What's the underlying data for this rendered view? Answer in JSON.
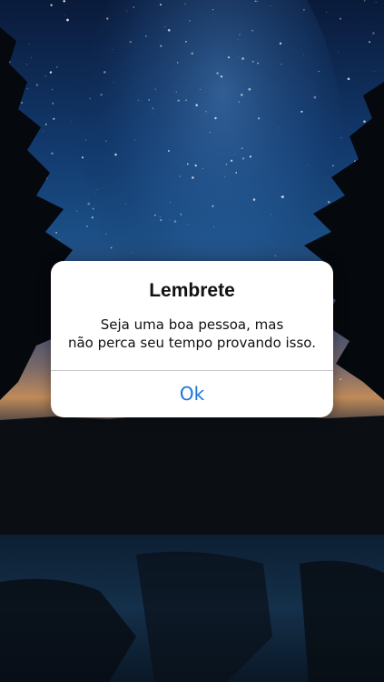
{
  "alert": {
    "title": "Lembrete",
    "message_line1": "Seja uma boa pessoa, mas",
    "message_line2": "não perca seu tempo provando isso.",
    "ok_label": "Ok"
  },
  "colors": {
    "alert_background": "#ffffff",
    "button_text": "#1a73d9",
    "divider": "#c8c8cc"
  }
}
